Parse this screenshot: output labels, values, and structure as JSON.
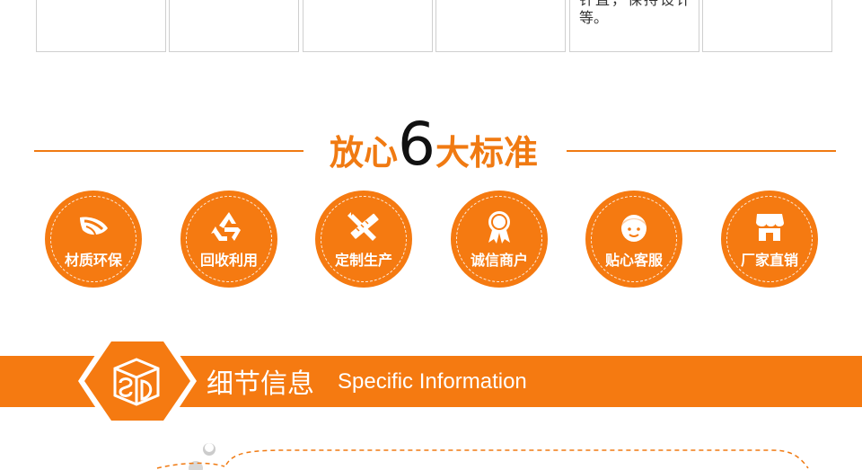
{
  "top_table": {
    "cells": [
      "",
      "",
      "",
      "",
      "",
      ""
    ],
    "cut_text": "针直，保持设计",
    "cell5_text": "等。"
  },
  "standards": {
    "title_before": "放心",
    "title_number": "6",
    "title_after": "大标准",
    "items": [
      {
        "label": "材质环保",
        "icon": "leaf-icon"
      },
      {
        "label": "回收利用",
        "icon": "recycle-icon"
      },
      {
        "label": "定制生产",
        "icon": "ruler-pencil-icon"
      },
      {
        "label": "诚信商户",
        "icon": "award-ribbon-icon"
      },
      {
        "label": "贴心客服",
        "icon": "customer-service-icon"
      },
      {
        "label": "厂家直销",
        "icon": "storefront-icon"
      }
    ]
  },
  "detail": {
    "title_cn": "细节信息",
    "title_en": "Specific Information",
    "logo_icon": "sd-box-logo-icon"
  },
  "colors": {
    "accent": "#f57a11",
    "line": "#f07a12",
    "text_dark": "#111111"
  }
}
